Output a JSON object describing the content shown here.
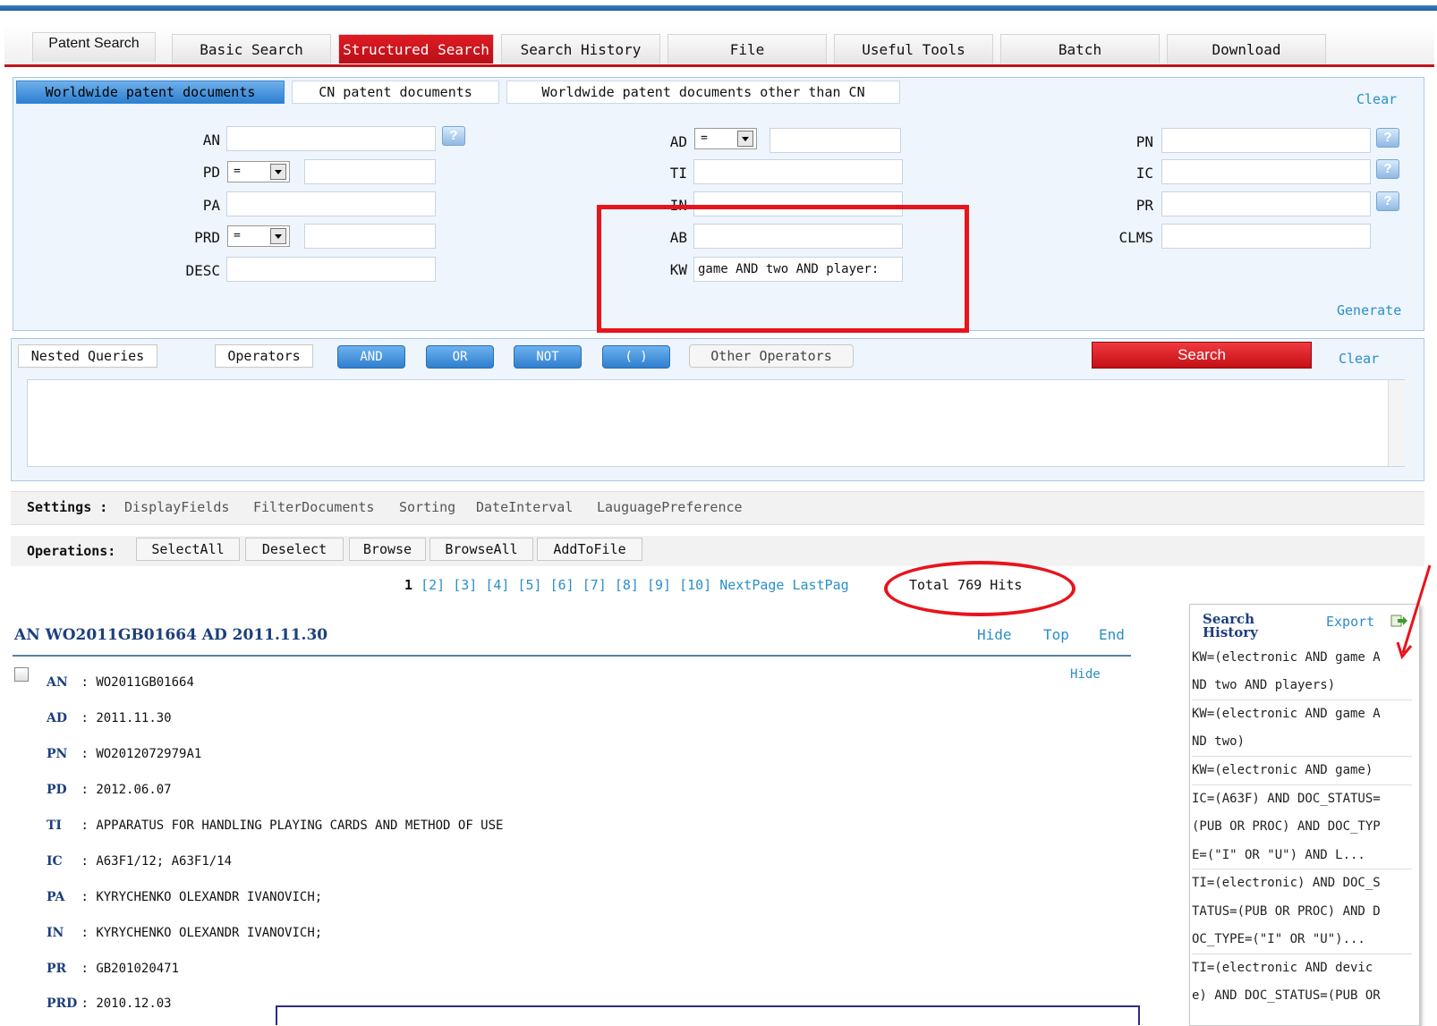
{
  "main_tabs": [
    "Patent Search",
    "Basic Search",
    "Structured Search",
    "Search History",
    "File",
    "Useful Tools",
    "Batch",
    "Download"
  ],
  "sub_tabs": [
    "Worldwide patent documents",
    "CN patent documents",
    "Worldwide patent documents other than CN"
  ],
  "clear_label": "Clear",
  "generate_label": "Generate",
  "fields": {
    "an": "AN",
    "ad": "AD",
    "pn": "PN",
    "pd": "PD",
    "ti": "TI",
    "ic": "IC",
    "pa": "PA",
    "in": "IN",
    "pr": "PR",
    "prd": "PRD",
    "ab": "AB",
    "clms": "CLMS",
    "desc": "DESC",
    "kw": "KW"
  },
  "selects": {
    "ad": "=",
    "pd": "=",
    "prd": "="
  },
  "help_glyph": "?",
  "kw_value": "game AND two AND player:",
  "query_tabs": [
    "Nested Queries",
    "Operators"
  ],
  "operators": [
    "AND",
    "OR",
    "NOT",
    "( )",
    "Other Operators"
  ],
  "search_label": "Search",
  "settings": {
    "label": "Settings :",
    "items": [
      "DisplayFields",
      "FilterDocuments",
      "Sorting",
      "DateInterval",
      "LauguagePreference"
    ]
  },
  "operations": {
    "label": "Operations:",
    "buttons": [
      "SelectAll",
      "Deselect",
      "Browse",
      "BrowseAll",
      "AddToFile"
    ]
  },
  "pagination": {
    "current": "1",
    "pages": [
      "[2]",
      "[3]",
      "[4]",
      "[5]",
      "[6]",
      "[7]",
      "[8]",
      "[9]",
      "[10]"
    ],
    "next": "NextPage",
    "last": "LastPag",
    "total": "Total 769 Hits"
  },
  "result": {
    "header": "AN WO2011GB01664 AD 2011.11.30",
    "hide": "Hide",
    "top": "Top",
    "end": "End",
    "hide2": "Hide",
    "rows": [
      {
        "k": "AN",
        "v": "WO2011GB01664"
      },
      {
        "k": "AD",
        "v": "2011.11.30"
      },
      {
        "k": "PN",
        "v": "WO2012072979A1"
      },
      {
        "k": "PD",
        "v": "2012.06.07"
      },
      {
        "k": "TI",
        "v": "APPARATUS FOR HANDLING PLAYING CARDS AND METHOD OF USE"
      },
      {
        "k": "IC",
        "v": "A63F1/12; A63F1/14"
      },
      {
        "k": "PA",
        "v": "KYRYCHENKO OLEXANDR IVANOVICH;"
      },
      {
        "k": "IN",
        "v": "KYRYCHENKO OLEXANDR IVANOVICH;"
      },
      {
        "k": "PR",
        "v": "GB201020471"
      },
      {
        "k": "PRD",
        "v": "2010.12.03"
      }
    ],
    "sep": ":"
  },
  "search_history": {
    "title": "Search History",
    "export": "Export",
    "lines": [
      "KW=(electronic AND game A",
      "ND two AND players)",
      "KW=(electronic AND game A",
      "ND two)",
      "KW=(electronic AND game)",
      "IC=(A63F) AND DOC_STATUS=",
      "(PUB OR PROC) AND DOC_TYP",
      "E=(\"I\" OR \"U\") AND L...",
      "TI=(electronic) AND DOC_S",
      "TATUS=(PUB OR PROC) AND D",
      "OC_TYPE=(\"I\" OR \"U\")...",
      "TI=(electronic AND devic",
      "e) AND DOC_STATUS=(PUB OR"
    ]
  },
  "colors": {
    "accent": "#e8141c",
    "link": "#2a8fc8",
    "tab_blue": "#2c7fd0"
  }
}
